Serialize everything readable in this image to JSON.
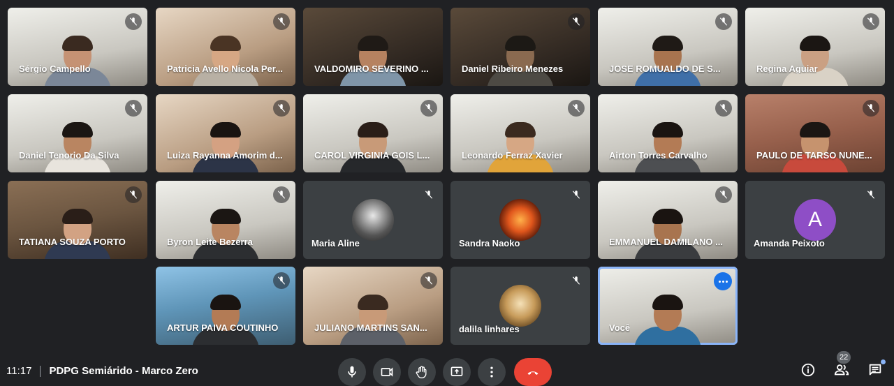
{
  "participants": [
    {
      "name": "Sérgio Campello"
    },
    {
      "name": "Patricia Avello Nicola Per..."
    },
    {
      "name": "VALDOMIRO SEVERINO ..."
    },
    {
      "name": "Daniel Ribeiro Menezes"
    },
    {
      "name": "JOSE ROMUALDO DE S..."
    },
    {
      "name": "Regina Aguiar"
    },
    {
      "name": "Daniel Tenorio Da Silva"
    },
    {
      "name": "Luiza Rayanna Amorim d..."
    },
    {
      "name": "CAROL VIRGINIA GOIS L..."
    },
    {
      "name": "Leonardo Ferraz Xavier"
    },
    {
      "name": "Airton Torres Carvalho"
    },
    {
      "name": "PAULO DE TARSO NUNE..."
    },
    {
      "name": "TATIANA SOUZA PORTO"
    },
    {
      "name": "Byron Leite Bezerra"
    },
    {
      "name": "Maria Aline"
    },
    {
      "name": "Sandra Naoko"
    },
    {
      "name": "EMMANUEL DAMILANO ..."
    },
    {
      "name": "Amanda Peixoto",
      "avatar_letter": "A",
      "avatar_color": "#8e4ec6"
    },
    {
      "name": "ARTUR PAIVA COUTINHO"
    },
    {
      "name": "JULIANO MARTINS SAN..."
    },
    {
      "name": "dalila linhares"
    },
    {
      "name": "Você"
    }
  ],
  "bottom_bar": {
    "time": "11:17",
    "meeting_title": "PDPG Semiárido - Marco Zero",
    "participant_count": "22"
  },
  "icons": {
    "mic": "microphone-icon",
    "camera": "camera-icon",
    "raise_hand": "hand-icon",
    "present": "present-screen-icon",
    "more": "more-vert-icon",
    "hangup": "hangup-icon",
    "info": "info-icon",
    "people": "people-icon",
    "chat": "chat-icon"
  },
  "colors": {
    "background": "#202124",
    "tile": "#3c4043",
    "hangup": "#ea4335",
    "self_outline": "#8ab4f8",
    "accent": "#1a73e8"
  }
}
